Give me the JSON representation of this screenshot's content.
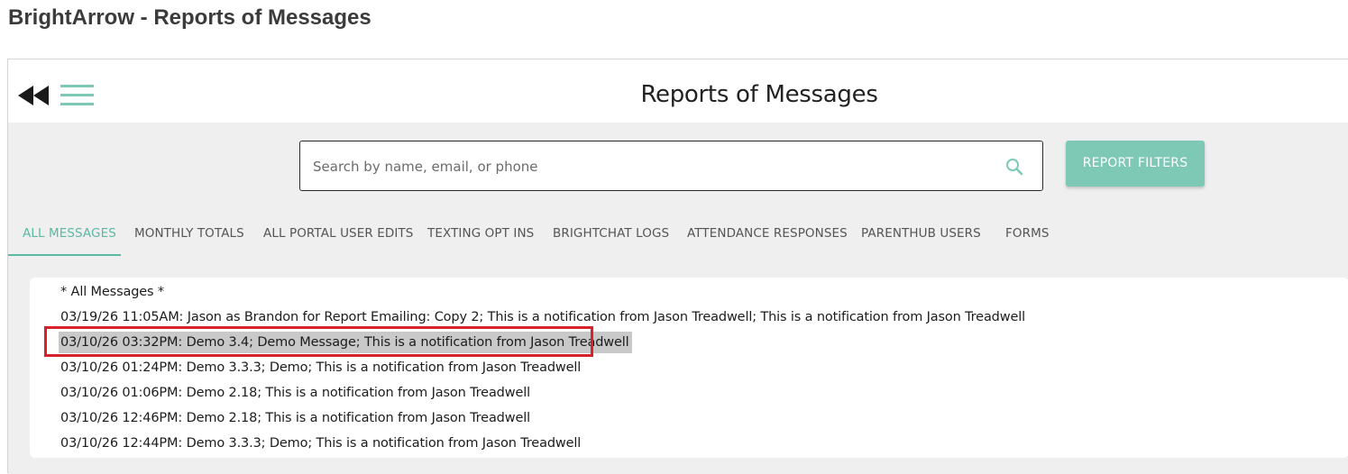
{
  "window": {
    "title": "BrightArrow - Reports of Messages"
  },
  "header": {
    "page_title": "Reports of Messages",
    "back_icon": "double-left-triangle-icon",
    "menu_icon": "hamburger-menu-icon"
  },
  "search": {
    "placeholder": "Search by name, email, or phone",
    "value": "",
    "icon": "search-icon"
  },
  "filters": {
    "button_label": "REPORT FILTERS"
  },
  "tabs": [
    {
      "label": "ALL MESSAGES",
      "active": true
    },
    {
      "label": "MONTHLY TOTALS",
      "active": false
    },
    {
      "label": "ALL PORTAL USER EDITS",
      "active": false
    },
    {
      "label": "TEXTING OPT INS",
      "active": false
    },
    {
      "label": "BRIGHTCHAT LOGS",
      "active": false
    },
    {
      "label": "ATTENDANCE RESPONSES",
      "active": false
    },
    {
      "label": "PARENTHUB USERS",
      "active": false
    },
    {
      "label": "FORMS",
      "active": false
    }
  ],
  "messages": {
    "header": "* All Messages *",
    "items": [
      "03/19/26 11:05AM: Jason as Brandon for Report Emailing: Copy 2; This is a notification from Jason Treadwell; This is a notification from Jason Treadwell",
      "03/10/26 03:32PM: Demo 3.4; Demo Message; This is a notification from Jason Treadwell",
      "03/10/26 01:24PM: Demo 3.3.3; Demo; This is a notification from Jason Treadwell",
      "03/10/26 01:06PM: Demo 2.18; This is a notification from Jason Treadwell",
      "03/10/26 12:46PM: Demo 2.18; This is a notification from Jason Treadwell",
      "03/10/26 12:44PM: Demo 3.3.3; Demo; This is a notification from Jason Treadwell"
    ],
    "selected_index": 1
  },
  "colors": {
    "accent": "#5bb8a3",
    "button": "#7ec8b6",
    "highlight_border": "#d9212b",
    "selected_row": "#c9c9c9",
    "content_bg": "#efefef"
  }
}
